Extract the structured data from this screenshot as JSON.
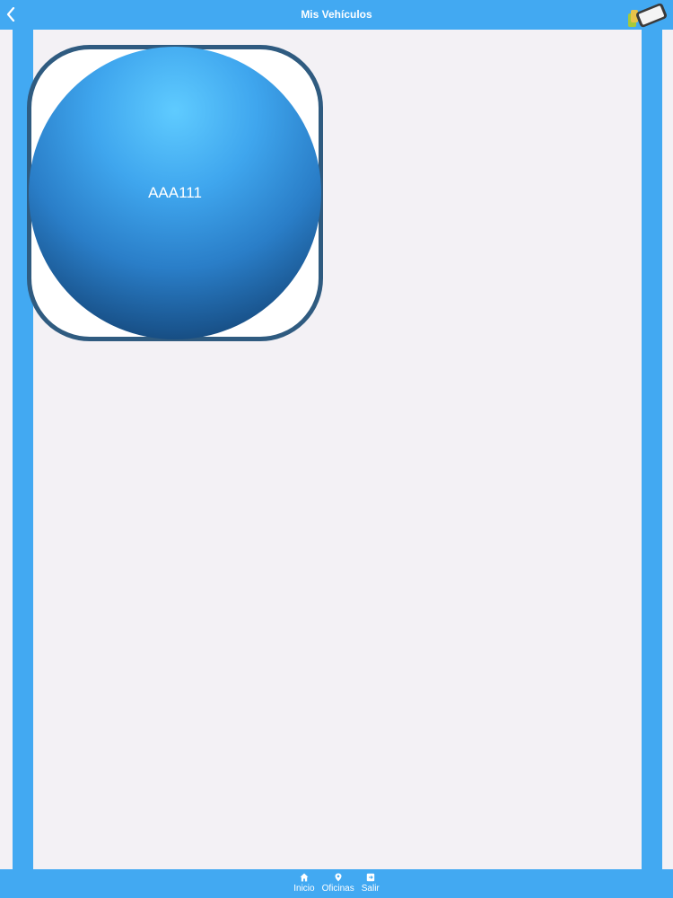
{
  "header": {
    "title": "Mis Vehículos",
    "back_icon": "chevron-left-icon",
    "logo_icon": "phone-logo-icon"
  },
  "vehicles": [
    {
      "plate": "AAA111"
    }
  ],
  "footer": {
    "tabs": [
      {
        "label": "Inicio",
        "icon": "home-icon"
      },
      {
        "label": "Oficinas",
        "icon": "map-pin-icon"
      },
      {
        "label": "Salir",
        "icon": "exit-icon"
      }
    ]
  },
  "colors": {
    "accent": "#42a9f2",
    "background": "#f3f1f5",
    "tile_border": "#2f5b80"
  }
}
